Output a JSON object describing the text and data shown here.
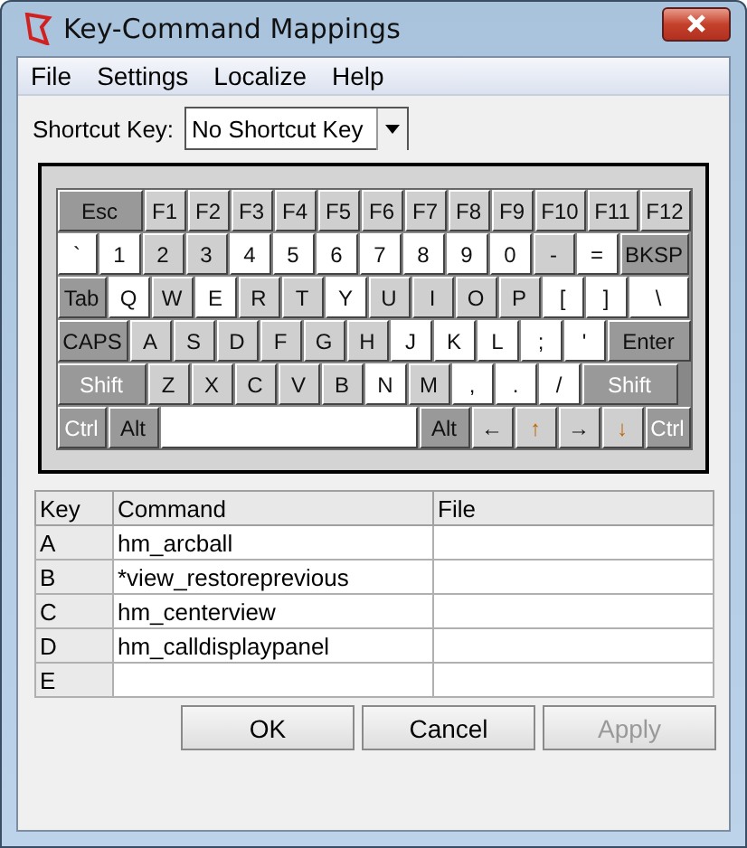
{
  "window": {
    "title": "Key-Command Mappings"
  },
  "menu": [
    "File",
    "Settings",
    "Localize",
    "Help"
  ],
  "shortcut": {
    "label": "Shortcut Key:",
    "value": "No Shortcut Key"
  },
  "keyboard": {
    "rows": [
      {
        "keys": [
          {
            "label": "Esc",
            "kind": "modifier"
          },
          {
            "label": "F1",
            "kind": "mapped"
          },
          {
            "label": "F2",
            "kind": "mapped"
          },
          {
            "label": "F3",
            "kind": "mapped"
          },
          {
            "label": "F4",
            "kind": "mapped"
          },
          {
            "label": "F5",
            "kind": "mapped"
          },
          {
            "label": "F6",
            "kind": "mapped"
          },
          {
            "label": "F7",
            "kind": "mapped"
          },
          {
            "label": "F8",
            "kind": "mapped"
          },
          {
            "label": "F9",
            "kind": "mapped"
          },
          {
            "label": "F10",
            "kind": "mapped"
          },
          {
            "label": "F11",
            "kind": "mapped"
          },
          {
            "label": "F12",
            "kind": "mapped"
          }
        ]
      },
      {
        "keys": [
          {
            "label": "`",
            "kind": "free"
          },
          {
            "label": "1",
            "kind": "free"
          },
          {
            "label": "2",
            "kind": "mapped"
          },
          {
            "label": "3",
            "kind": "mapped"
          },
          {
            "label": "4",
            "kind": "free"
          },
          {
            "label": "5",
            "kind": "free"
          },
          {
            "label": "6",
            "kind": "free"
          },
          {
            "label": "7",
            "kind": "free"
          },
          {
            "label": "8",
            "kind": "free"
          },
          {
            "label": "9",
            "kind": "free"
          },
          {
            "label": "0",
            "kind": "free"
          },
          {
            "label": "-",
            "kind": "mapped"
          },
          {
            "label": "=",
            "kind": "free"
          },
          {
            "label": "BKSP",
            "kind": "modifier"
          }
        ]
      },
      {
        "keys": [
          {
            "label": "Tab",
            "kind": "modifier"
          },
          {
            "label": "Q",
            "kind": "free"
          },
          {
            "label": "W",
            "kind": "mapped"
          },
          {
            "label": "E",
            "kind": "free"
          },
          {
            "label": "R",
            "kind": "mapped"
          },
          {
            "label": "T",
            "kind": "mapped"
          },
          {
            "label": "Y",
            "kind": "free"
          },
          {
            "label": "U",
            "kind": "mapped"
          },
          {
            "label": "I",
            "kind": "mapped"
          },
          {
            "label": "O",
            "kind": "mapped"
          },
          {
            "label": "P",
            "kind": "mapped"
          },
          {
            "label": "[",
            "kind": "free"
          },
          {
            "label": "]",
            "kind": "free"
          },
          {
            "label": "\\",
            "kind": "free"
          }
        ]
      },
      {
        "keys": [
          {
            "label": "CAPS",
            "kind": "modifier"
          },
          {
            "label": "A",
            "kind": "mapped"
          },
          {
            "label": "S",
            "kind": "mapped"
          },
          {
            "label": "D",
            "kind": "mapped"
          },
          {
            "label": "F",
            "kind": "mapped"
          },
          {
            "label": "G",
            "kind": "mapped"
          },
          {
            "label": "H",
            "kind": "mapped"
          },
          {
            "label": "J",
            "kind": "free"
          },
          {
            "label": "K",
            "kind": "free"
          },
          {
            "label": "L",
            "kind": "free"
          },
          {
            "label": ";",
            "kind": "free"
          },
          {
            "label": "'",
            "kind": "free"
          },
          {
            "label": "Enter",
            "kind": "modifier"
          }
        ]
      },
      {
        "keys": [
          {
            "label": "Shift",
            "kind": "toggle"
          },
          {
            "label": "Z",
            "kind": "mapped"
          },
          {
            "label": "X",
            "kind": "mapped"
          },
          {
            "label": "C",
            "kind": "mapped"
          },
          {
            "label": "V",
            "kind": "mapped"
          },
          {
            "label": "B",
            "kind": "mapped"
          },
          {
            "label": "N",
            "kind": "free"
          },
          {
            "label": "M",
            "kind": "mapped"
          },
          {
            "label": ",",
            "kind": "free"
          },
          {
            "label": ".",
            "kind": "free"
          },
          {
            "label": "/",
            "kind": "free"
          },
          {
            "label": "Shift",
            "kind": "toggle"
          }
        ]
      },
      {
        "keys": [
          {
            "label": "Ctrl",
            "kind": "toggle"
          },
          {
            "label": "Alt",
            "kind": "modifier"
          },
          {
            "kind": "space"
          },
          {
            "label": "Alt",
            "kind": "modifier"
          },
          {
            "label": "←",
            "kind": "mapped"
          },
          {
            "label": "↑",
            "kind": "mapped",
            "accent": true
          },
          {
            "label": "→",
            "kind": "mapped"
          },
          {
            "label": "↓",
            "kind": "mapped",
            "accent": true
          },
          {
            "label": "Ctrl",
            "kind": "toggle"
          }
        ]
      }
    ]
  },
  "table": {
    "columns": [
      "Key",
      "Command",
      "File"
    ],
    "rows": [
      [
        "A",
        "hm_arcball",
        ""
      ],
      [
        "B",
        "*view_restoreprevious",
        ""
      ],
      [
        "C",
        "hm_centerview",
        ""
      ],
      [
        "D",
        "hm_calldisplaypanel",
        ""
      ],
      [
        "E",
        "",
        ""
      ]
    ]
  },
  "buttons": [
    {
      "label": "OK",
      "disabled": false
    },
    {
      "label": "Cancel",
      "disabled": false
    },
    {
      "label": "Apply",
      "disabled": true
    }
  ]
}
